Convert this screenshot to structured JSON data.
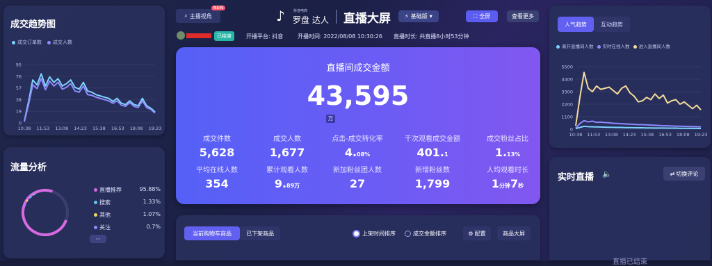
{
  "left_top": {
    "title": "成交趋势图",
    "legend": [
      "成交订单数",
      "成交人数"
    ],
    "colors": [
      "#7fd3ff",
      "#8f8bff"
    ]
  },
  "deal_chart": {
    "type": "line",
    "y_ticks": [
      "95",
      "76",
      "57",
      "38",
      "19",
      "0"
    ],
    "x_ticks": [
      "10:38",
      "11:53",
      "13:08",
      "14:23",
      "15:38",
      "16:53",
      "18:08",
      "19:23"
    ],
    "ylim": [
      0,
      95
    ],
    "series": [
      {
        "name": "成交订单数",
        "values": [
          3,
          35,
          70,
          62,
          80,
          60,
          75,
          66,
          72,
          60,
          64,
          70,
          58,
          55,
          66,
          52,
          50,
          46,
          44,
          42,
          40,
          35,
          40,
          32,
          30,
          36,
          30,
          28,
          40,
          28,
          24,
          18
        ]
      },
      {
        "name": "成交人数",
        "values": [
          2,
          30,
          62,
          56,
          72,
          54,
          68,
          60,
          66,
          55,
          58,
          64,
          52,
          50,
          60,
          46,
          45,
          42,
          40,
          38,
          36,
          32,
          36,
          29,
          27,
          33,
          27,
          25,
          36,
          25,
          22,
          16
        ]
      }
    ]
  },
  "traffic": {
    "title": "流量分析",
    "more": "···",
    "sources": [
      {
        "name": "直播推荐",
        "pct": "95.88%",
        "color": "#d66be0"
      },
      {
        "name": "搜索",
        "pct": "1.33%",
        "color": "#62c8f0"
      },
      {
        "name": "其他",
        "pct": "1.07%",
        "color": "#f5d65a"
      },
      {
        "name": "关注",
        "pct": "0.7%",
        "color": "#8f8bff"
      }
    ]
  },
  "header": {
    "anchor_view": "主播视角",
    "badge": "NEW",
    "brand_small": "抖音电商",
    "brand": "罗盘 达人",
    "title": "直播大屏",
    "version": "基础版",
    "fullscreen": "全屏",
    "more": "查看更多",
    "status": "已结束",
    "platform": "开播平台: 抖音",
    "start_time": "开播时间: 2022/08/08 10:30:26",
    "duration": "直播时长: 共直播8小时53分钟"
  },
  "main": {
    "title": "直播间成交金额",
    "amount": "43,595",
    "unit": "万",
    "stats": [
      {
        "label": "成交件数",
        "value": "5,628",
        "suffix": ""
      },
      {
        "label": "成交人数",
        "value": "1,677",
        "suffix": ""
      },
      {
        "label": "点击-成交转化率",
        "value": "4.",
        "suffix": "08%"
      },
      {
        "label": "千次观看成交金额",
        "value": "401.",
        "suffix": "1"
      },
      {
        "label": "成交粉丝占比",
        "value": "1.",
        "suffix": "13%"
      },
      {
        "label": "平均在线人数",
        "value": "354",
        "suffix": ""
      },
      {
        "label": "累计观看人数",
        "value": "9.",
        "suffix": "89万"
      },
      {
        "label": "新加粉丝团人数",
        "value": "27",
        "suffix": ""
      },
      {
        "label": "新增粉丝数",
        "value": "1,799",
        "suffix": ""
      },
      {
        "label": "人均观看时长",
        "value": "1",
        "suffix": "分钟",
        "value2": "7",
        "suffix2": "秒"
      }
    ]
  },
  "products": {
    "tab_active": "当前购物车商品",
    "tab_other": "已下架商品",
    "sort1": "上架时间排序",
    "sort2": "成交金额排序",
    "config": "配置",
    "screen": "商品大屏"
  },
  "right_top": {
    "tabs": [
      "人气趋势",
      "互动趋势"
    ],
    "legend": [
      "离开直播间人数",
      "实时在线人数",
      "进入直播间人数"
    ],
    "colors": [
      "#7fd3ff",
      "#8f8bff",
      "#f5dc9a"
    ],
    "y_ticks": [
      "5500",
      "4400",
      "3300",
      "2200",
      "1100",
      "0"
    ],
    "x_ticks": [
      "10:38",
      "11:53",
      "13:08",
      "14:23",
      "15:38",
      "16:53",
      "18:08",
      "19:23"
    ],
    "ylim": [
      0,
      5500
    ],
    "series": [
      {
        "name": "进入直播间人数",
        "values": [
          300,
          2800,
          5000,
          3600,
          3300,
          3800,
          3500,
          3600,
          3700,
          3400,
          3100,
          3600,
          3800,
          3200,
          2900,
          2400,
          2500,
          2800,
          2600,
          3100,
          2700,
          3000,
          2300,
          2500,
          2600,
          2200,
          2400,
          2100,
          1800,
          2100,
          1700
        ]
      },
      {
        "name": "实时在线人数",
        "values": [
          100,
          500,
          750,
          650,
          700,
          600,
          620,
          580,
          560,
          520,
          500,
          480,
          460,
          440,
          420,
          400,
          400,
          380,
          360,
          340,
          320,
          300,
          300,
          280,
          270,
          260,
          250,
          240,
          230,
          220,
          210
        ]
      },
      {
        "name": "离开直播间人数",
        "values": [
          50,
          150,
          250,
          220,
          210,
          200,
          190,
          180,
          170,
          160,
          150,
          150,
          140,
          140,
          130,
          120,
          120,
          110,
          110,
          100,
          100,
          100,
          90,
          90,
          90,
          80,
          80,
          80,
          70,
          70,
          60
        ]
      }
    ]
  },
  "live": {
    "title": "实时直播",
    "switch": "切换评论",
    "ended": "直播已结束"
  }
}
